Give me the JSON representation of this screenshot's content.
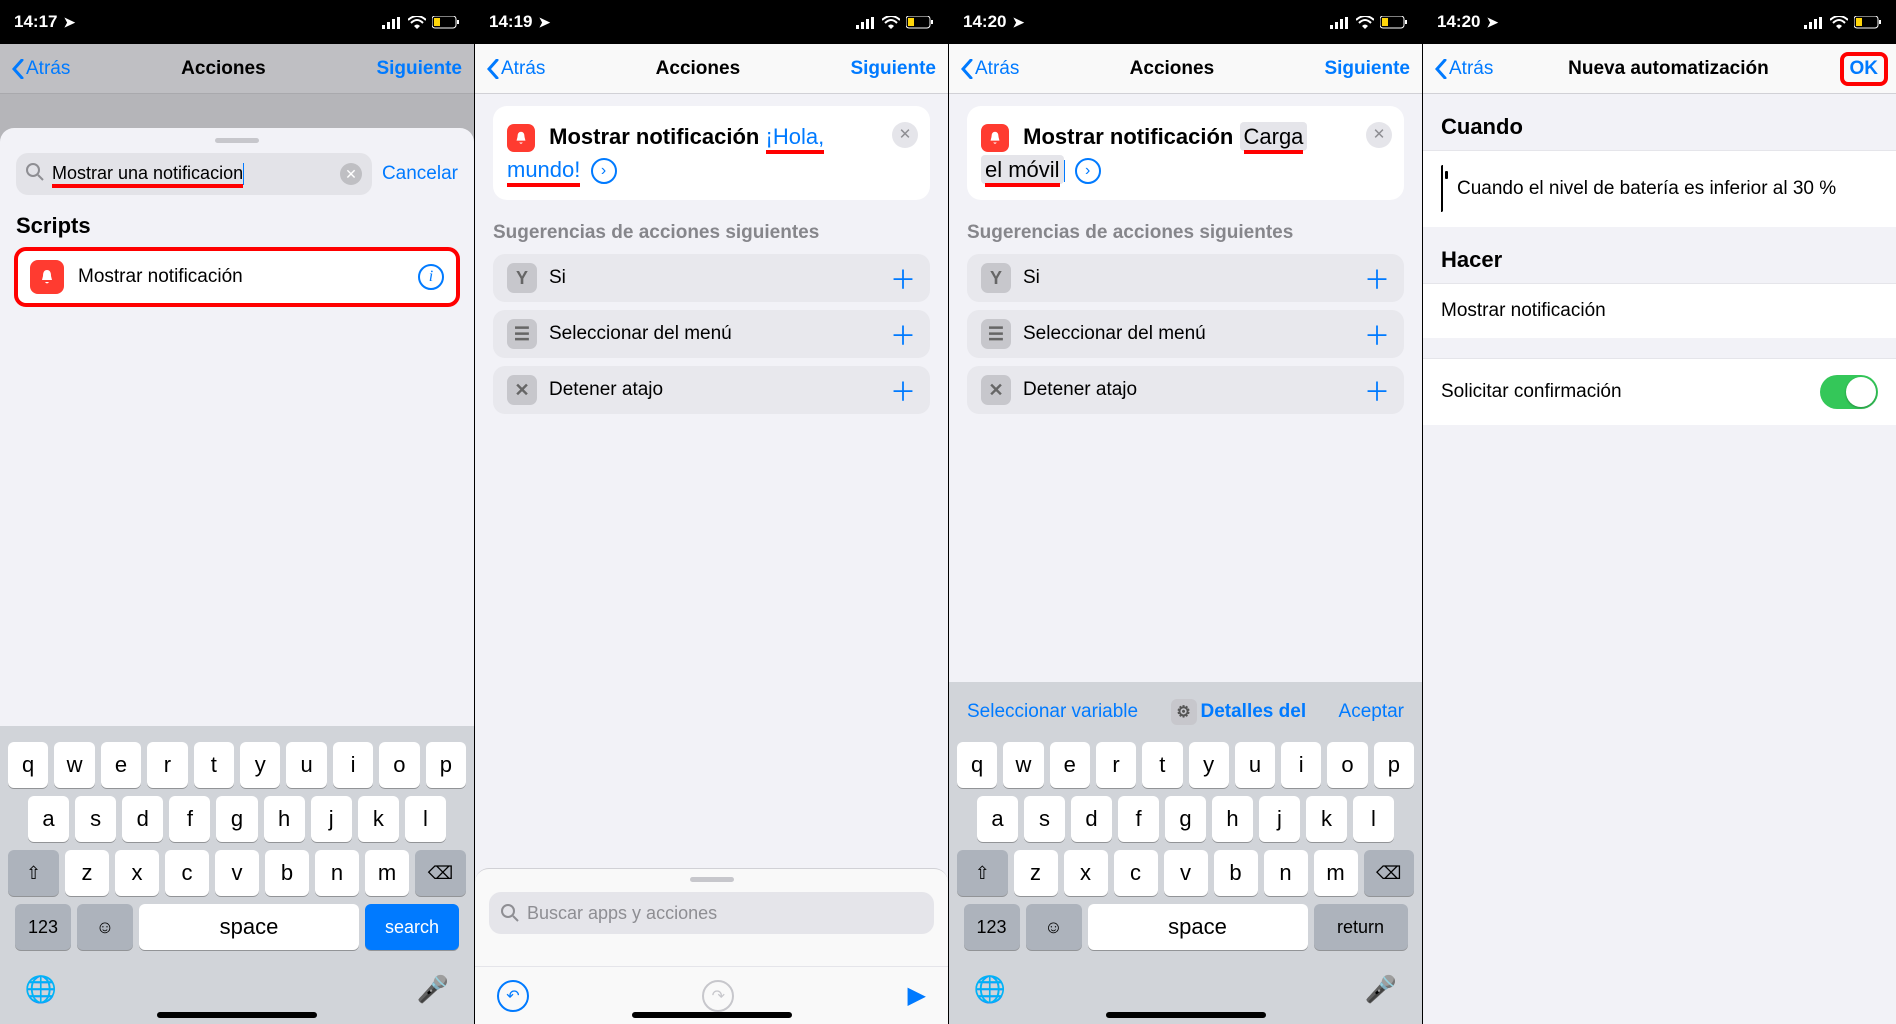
{
  "screens": {
    "s1": {
      "time": "14:17",
      "nav": {
        "back": "Atrás",
        "title": "Acciones",
        "next": "Siguiente"
      },
      "search": {
        "value": "Mostrar una notificacion",
        "cancel": "Cancelar"
      },
      "section": "Scripts",
      "result": "Mostrar notificación"
    },
    "s2": {
      "time": "14:19",
      "nav": {
        "back": "Atrás",
        "title": "Acciones",
        "next": "Siguiente"
      },
      "action_prefix": "Mostrar notificación",
      "action_param": "¡Hola, mundo!",
      "sugg_header": "Sugerencias de acciones siguientes",
      "suggestions": [
        "Si",
        "Seleccionar del menú",
        "Detener atajo"
      ],
      "bottom_search_placeholder": "Buscar apps y acciones"
    },
    "s3": {
      "time": "14:20",
      "nav": {
        "back": "Atrás",
        "title": "Acciones",
        "next": "Siguiente"
      },
      "action_prefix": "Mostrar notificación",
      "action_param_l1": "Carga",
      "action_param_l2": "el móvil",
      "sugg_header": "Sugerencias de acciones siguientes",
      "suggestions": [
        "Si",
        "Seleccionar del menú",
        "Detener atajo"
      ],
      "kbd_bar": {
        "left": "Seleccionar variable",
        "center": "Detalles del",
        "right": "Aceptar"
      }
    },
    "s4": {
      "time": "14:20",
      "nav": {
        "back": "Atrás",
        "title": "Nueva automatización",
        "ok": "OK"
      },
      "when_h": "Cuando",
      "when_text": "Cuando el nivel de batería es inferior al 30 %",
      "do_h": "Hacer",
      "do_text": "Mostrar notificación",
      "confirm": "Solicitar confirmación"
    }
  },
  "kbd": {
    "row1": [
      "q",
      "w",
      "e",
      "r",
      "t",
      "y",
      "u",
      "i",
      "o",
      "p"
    ],
    "row2": [
      "a",
      "s",
      "d",
      "f",
      "g",
      "h",
      "j",
      "k",
      "l"
    ],
    "row3": [
      "z",
      "x",
      "c",
      "v",
      "b",
      "n",
      "m"
    ],
    "num": "123",
    "space": "space",
    "search": "search",
    "return": "return"
  }
}
